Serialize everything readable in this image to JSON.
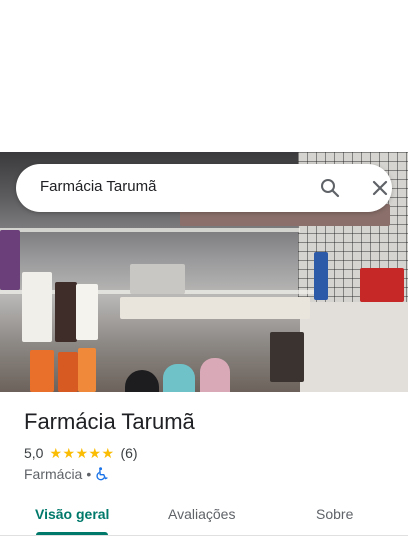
{
  "search": {
    "query": "Farmácia Tarumã",
    "search_icon": "search-icon",
    "close_icon": "close-icon"
  },
  "place": {
    "title": "Farmácia Tarumã",
    "rating": "5,0",
    "stars": 5,
    "reviews": "(6)",
    "category": "Farmácia",
    "separator": "•",
    "accessibility_icon": "wheelchair-icon"
  },
  "tabs": [
    {
      "label": "Visão geral",
      "active": true
    },
    {
      "label": "Avaliações",
      "active": false
    },
    {
      "label": "Sobre",
      "active": false
    }
  ],
  "colors": {
    "accent": "#00796b",
    "star": "#fbbc04",
    "accessibility": "#1a73e8"
  }
}
